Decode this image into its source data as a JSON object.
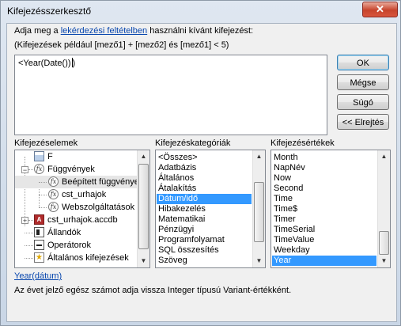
{
  "window": {
    "title": "Kifejezésszerkesztő",
    "close_glyph": "✕"
  },
  "prompt": {
    "line1_before": "Adja meg a ",
    "line1_link": "lekérdezési feltételben",
    "line1_after": " használni kívánt kifejezést:",
    "line2": "(Kifejezések például [mező1] + [mező2] és [mező1] < 5)"
  },
  "expression": {
    "value": "<Year(Date())"
  },
  "buttons": {
    "ok": "OK",
    "cancel": "Mégse",
    "help": "Súgó",
    "collapse": "<< Elrejtés"
  },
  "elements": {
    "label": "Kifejezéselemek",
    "tree": [
      {
        "label": "F",
        "icon": "form-icon",
        "expander": ""
      },
      {
        "label": "Függvények",
        "icon": "function-icon",
        "expander": "−"
      },
      {
        "label": "Beépített függvények",
        "icon": "function-icon",
        "expander": ""
      },
      {
        "label": "cst_urhajok",
        "icon": "function-icon",
        "expander": ""
      },
      {
        "label": "Webszolgáltatások",
        "icon": "function-icon",
        "expander": ""
      },
      {
        "label": "cst_urhajok.accdb",
        "icon": "database-icon",
        "expander": "+"
      },
      {
        "label": "Állandók",
        "icon": "constants-icon",
        "expander": ""
      },
      {
        "label": "Operátorok",
        "icon": "operators-icon",
        "expander": ""
      },
      {
        "label": "Általános kifejezések",
        "icon": "common-expressions-icon",
        "expander": ""
      }
    ]
  },
  "categories": {
    "label": "Kifejezéskategóriák",
    "items": [
      "<Összes>",
      "Adatbázis",
      "Általános",
      "Átalakítás",
      "Dátum/idő",
      "Hibakezelés",
      "Matematikai",
      "Pénzügyi",
      "Programfolyamat",
      "SQL összesítés",
      "Szöveg"
    ],
    "selected": "Dátum/idő"
  },
  "values": {
    "label": "Kifejezésértékek",
    "items": [
      "Month",
      "NapNév",
      "Now",
      "Second",
      "Time",
      "Time$",
      "Timer",
      "TimeSerial",
      "TimeValue",
      "Weekday",
      "Year"
    ],
    "selected": "Year"
  },
  "syntax": {
    "link": "Year(dátum)"
  },
  "description": "Az évet jelző egész számot adja vissza Integer típusú Variant-értékként.",
  "colors": {
    "selection": "#3399ff",
    "link": "#0645ad",
    "close_button": "#c7442c"
  }
}
